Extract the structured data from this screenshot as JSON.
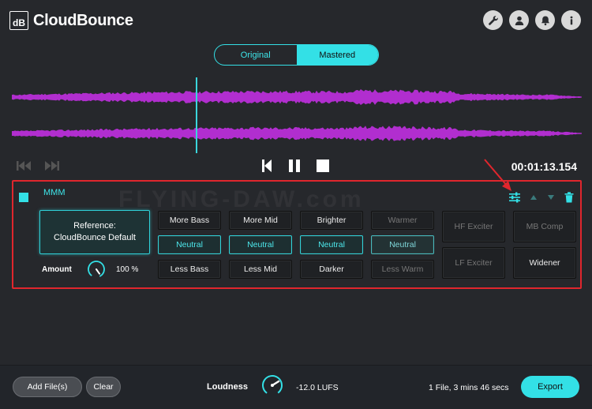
{
  "app": {
    "logo_mark": "dB",
    "name": "CloudBounce"
  },
  "header_icons": [
    "wrench-icon",
    "user-icon",
    "bell-icon",
    "info-icon"
  ],
  "toggle": {
    "original": "Original",
    "mastered": "Mastered",
    "selected": "Mastered"
  },
  "transport": {
    "timecode": "00:01:13.154"
  },
  "track": {
    "name": "MMM",
    "reference_line1": "Reference:",
    "reference_line2": "CloudBounce Default",
    "amount_label": "Amount",
    "amount_value": "100 %",
    "amount_level": 1.0
  },
  "grid": {
    "bass": {
      "top": "More Bass",
      "mid": "Neutral",
      "bottom": "Less Bass"
    },
    "mid": {
      "top": "More Mid",
      "mid": "Neutral",
      "bottom": "Less Mid"
    },
    "bright": {
      "top": "Brighter",
      "mid": "Neutral",
      "bottom": "Darker"
    },
    "warm": {
      "top": "Warmer",
      "mid": "Neutral",
      "bottom": "Less Warm"
    },
    "hf_exciter": "HF Exciter",
    "lf_exciter": "LF Exciter",
    "mb_comp": "MB Comp",
    "widener": "Widener"
  },
  "watermark": "FLYING-DAW.com",
  "bottom": {
    "add_files": "Add File(s)",
    "clear": "Clear",
    "loudness_label": "Loudness",
    "loudness_value": "-12.0 LUFS",
    "file_info": "1 File, 3 mins 46 secs",
    "export": "Export"
  },
  "colors": {
    "accent": "#33e0e6",
    "waveform": "#b12ecf",
    "highlight": "#e0262d",
    "background": "#26282c"
  }
}
